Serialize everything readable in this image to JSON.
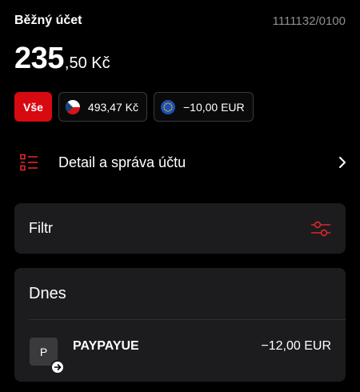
{
  "account": {
    "name": "Běžný účet",
    "number": "1111132/0100",
    "balance_integer": "235",
    "balance_decimal": ",50 Kč"
  },
  "filters": {
    "all_label": "Vše",
    "currencies": [
      {
        "amount": "493,47 Kč",
        "flag": "czech-flag-icon"
      },
      {
        "amount": "−10,00 EUR",
        "flag": "eu-flag-icon"
      }
    ]
  },
  "detail": {
    "label": "Detail a správa účtu",
    "icon": "list-icon"
  },
  "filter_card": {
    "label": "Filtr",
    "icon": "sliders-icon"
  },
  "transactions": {
    "day_label": "Dnes",
    "items": [
      {
        "initial": "P",
        "name": "PAYPAYUE",
        "amount": "−12,00 EUR",
        "badge": "arrow-right-icon"
      }
    ]
  },
  "colors": {
    "accent": "#d60a10",
    "background": "#000000",
    "card": "#1c1c1e",
    "muted_text": "#8e8e93"
  }
}
